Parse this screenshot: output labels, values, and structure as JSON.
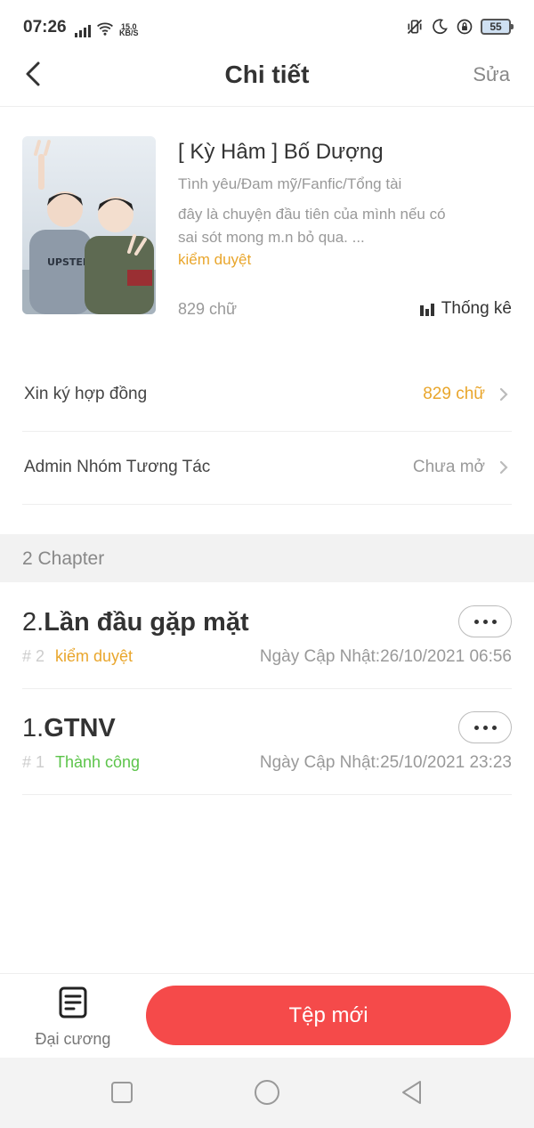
{
  "status_bar": {
    "time": "07:26",
    "net_speed_value": "15.0",
    "net_speed_unit": "KB/S",
    "battery": "55"
  },
  "header": {
    "title": "Chi tiết",
    "edit_label": "Sửa",
    "back_icon": "chevron-left-icon"
  },
  "book": {
    "title": "[ Kỳ Hâm ] Bố Dượng",
    "tags": "Tình yêu/Đam mỹ/Fanfic/Tổng tài",
    "description_line1": "đây là chuyện đầu tiên của mình nếu có",
    "description_line2": "sai sót mong m.n bỏ qua. ...",
    "status": "kiểm duyệt",
    "word_count": "829 chữ",
    "stats_label": "Thống kê"
  },
  "rows": [
    {
      "label": "Xin ký hợp đồng",
      "value": "829 chữ",
      "value_color": "#e9a62c"
    },
    {
      "label": "Admin Nhóm Tương Tác",
      "value": "Chưa mở",
      "value_color": "#999999"
    }
  ],
  "section": {
    "label": "2 Chapter"
  },
  "chapters": [
    {
      "number_prefix": "2.",
      "title": "Lần đầu gặp mặt",
      "id": "# 2",
      "status": "kiểm duyệt",
      "status_color": "#e9a62c",
      "date": "Ngày Cập Nhật:26/10/2021 06:56"
    },
    {
      "number_prefix": "1.",
      "title": "GTNV",
      "id": "# 1",
      "status": "Thành công",
      "status_color": "#5cc44a",
      "date": "Ngày Cập Nhật:25/10/2021 23:23"
    }
  ],
  "bottom_bar": {
    "outline_label": "Đại cương",
    "new_button_label": "Tệp mới"
  },
  "colors": {
    "accent": "#f54a4a",
    "warning": "#e9a62c",
    "success": "#5cc44a"
  }
}
